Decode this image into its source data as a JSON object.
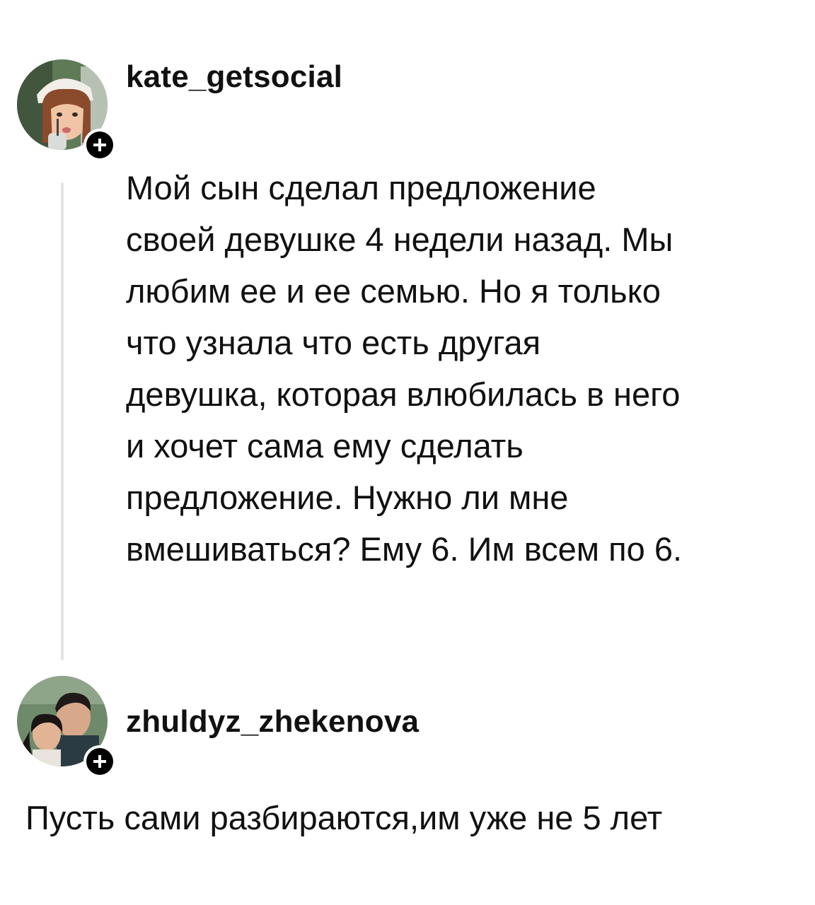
{
  "posts": [
    {
      "username": "kate_getsocial",
      "avatar_icon": "profile-photo",
      "follow_icon": "plus-icon",
      "text_lines": [
        "Мой сын сделал предложение",
        "своей девушке 4 недели назад. Мы",
        "любим ее и ее семью. Но я только",
        "что узнала что есть другая",
        "девушка, которая влюбилась в него",
        "и хочет сама ему сделать",
        "предложение. Нужно ли мне",
        "вмешиваться? Ему 6. Им всем по 6."
      ]
    },
    {
      "username": "zhuldyz_zhekenova",
      "avatar_icon": "profile-photo",
      "follow_icon": "plus-icon",
      "text_lines": [
        "Пусть сами разбираются,им уже не 5 лет"
      ]
    }
  ],
  "colors": {
    "text": "#111111",
    "thread_line": "#e3e3e3",
    "badge": "#000000"
  }
}
